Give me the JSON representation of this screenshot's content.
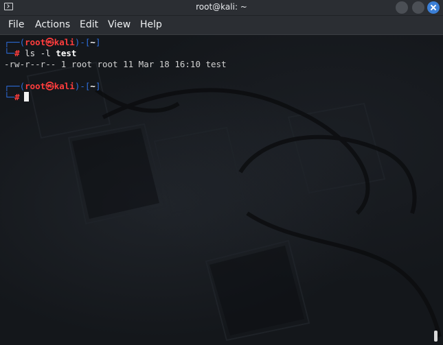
{
  "window": {
    "title": "root@kali: ~",
    "icon": "terminal-icon",
    "buttons": [
      "minimize-button",
      "maximize-button",
      "close-button"
    ],
    "accent": "#3b7fd6"
  },
  "menu": {
    "file": "File",
    "actions": "Actions",
    "edit": "Edit",
    "view": "View",
    "help": "Help"
  },
  "terminal": {
    "prompt1": {
      "corner": "┌──(",
      "user": "root",
      "at": "㉿",
      "host": "kali",
      "mid": ")-[",
      "dir": "~",
      "end": "]"
    },
    "cmd1": {
      "corner": "└─",
      "hash": "#",
      "cmd": "ls -l",
      "arg": "test"
    },
    "output1": "-rw-r--r-- 1 root root 11 Mar 18 16:10 test",
    "prompt2": {
      "corner": "┌──(",
      "user": "root",
      "at": "㉿",
      "host": "kali",
      "mid": ")-[",
      "dir": "~",
      "end": "]"
    },
    "cmd2": {
      "corner": "└─",
      "hash": "#"
    },
    "colors": {
      "prompt_frame": "#2d6fe0",
      "prompt_user": "#ff3d3d",
      "text": "#e6e6e6"
    }
  }
}
